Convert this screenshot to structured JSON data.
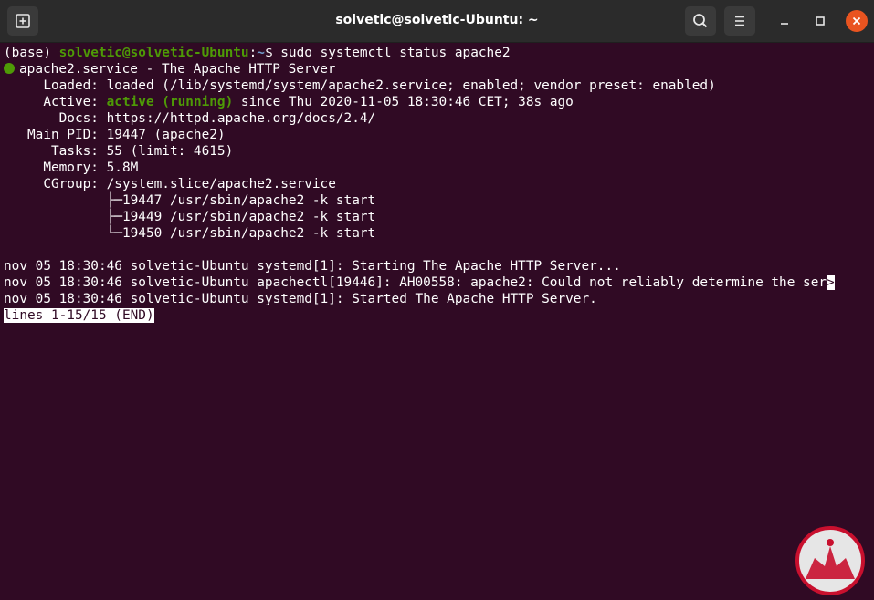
{
  "titlebar": {
    "title": "solvetic@solvetic-Ubuntu: ~",
    "icons": [
      "new-tab-icon",
      "search-icon",
      "hamburger-menu-icon",
      "minimize-icon",
      "maximize-icon",
      "close-icon"
    ]
  },
  "colors": {
    "terminal_bg": "#300a24",
    "titlebar_bg": "#2b2b2b",
    "prompt_green": "#4e9a06",
    "prompt_blue": "#729fcf",
    "close_button": "#e95420"
  },
  "terminal": {
    "prompt": {
      "env": "(base) ",
      "userhost": "solvetic@solvetic-Ubuntu",
      "sep": ":",
      "cwd": "~",
      "dollar": "$ ",
      "command": "sudo systemctl status apache2"
    },
    "service_title": "apache2.service - The Apache HTTP Server",
    "loaded": "     Loaded: loaded (/lib/systemd/system/apache2.service; enabled; vendor preset: enabled)",
    "active_label": "     Active: ",
    "active_state": "active (running)",
    "active_rest": " since Thu 2020-11-05 18:30:46 CET; 38s ago",
    "docs": "       Docs: https://httpd.apache.org/docs/2.4/",
    "main_pid": "   Main PID: 19447 (apache2)",
    "tasks": "      Tasks: 55 (limit: 4615)",
    "memory": "     Memory: 5.8M",
    "cgroup": "     CGroup: /system.slice/apache2.service",
    "tree": [
      "             ├─19447 /usr/sbin/apache2 -k start",
      "             ├─19449 /usr/sbin/apache2 -k start",
      "             └─19450 /usr/sbin/apache2 -k start"
    ],
    "logs": [
      "nov 05 18:30:46 solvetic-Ubuntu systemd[1]: Starting The Apache HTTP Server...",
      "nov 05 18:30:46 solvetic-Ubuntu apachectl[19446]: AH00558: apache2: Could not reliably determine the ser",
      "nov 05 18:30:46 solvetic-Ubuntu systemd[1]: Started The Apache HTTP Server."
    ],
    "truncation_marker": ">",
    "pager_status": "lines 1-15/15 (END)"
  },
  "watermark": {
    "logo": "solvetic-logo"
  }
}
